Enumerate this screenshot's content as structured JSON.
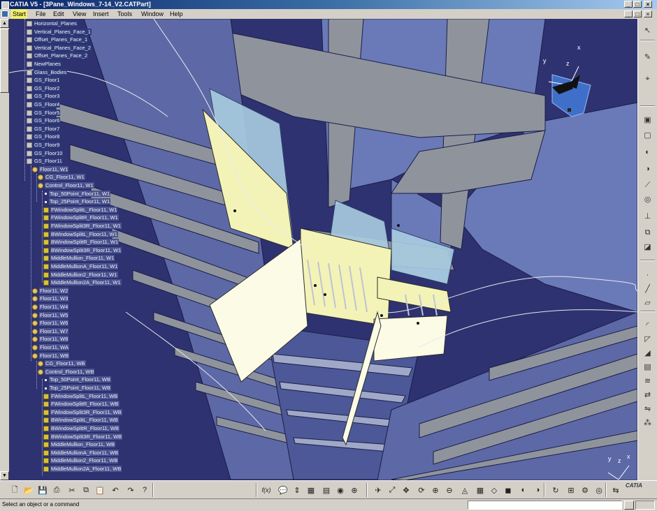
{
  "window": {
    "title": "CATIA V5 - [3Pane_Windows_7-14_V2.CATPart]",
    "buttons": [
      "_",
      "□",
      "×"
    ],
    "inner_buttons": [
      "_",
      "□",
      "×"
    ]
  },
  "menu": {
    "items": [
      "Start",
      "File",
      "Edit",
      "View",
      "Insert",
      "Tools",
      "Window",
      "Help"
    ]
  },
  "tree": {
    "nodes": [
      {
        "label": "Horizontal_Planes",
        "icon": "plane-icon",
        "level": 0
      },
      {
        "label": "Vertical_Planes_Face_1",
        "icon": "plane-icon",
        "level": 0
      },
      {
        "label": "Offset_Planes_Face_1",
        "icon": "plane-icon",
        "level": 0
      },
      {
        "label": "Vertical_Planes_Face_2",
        "icon": "plane-icon",
        "level": 0
      },
      {
        "label": "Offset_Planes_Face_2",
        "icon": "plane-icon",
        "level": 0
      },
      {
        "label": "NewPlanes",
        "icon": "plane-icon",
        "level": 0
      },
      {
        "label": "Glass_Bodies",
        "icon": "plane-icon",
        "level": 0
      },
      {
        "label": "GS_Floor1",
        "icon": "plane-icon",
        "level": 0
      },
      {
        "label": "GS_Floor2",
        "icon": "plane-icon",
        "level": 0
      },
      {
        "label": "GS_Floor3",
        "icon": "plane-icon",
        "level": 0
      },
      {
        "label": "GS_Floor4",
        "icon": "plane-icon",
        "level": 0
      },
      {
        "label": "GS_Floor5",
        "icon": "plane-icon",
        "level": 0
      },
      {
        "label": "GS_Floor6",
        "icon": "plane-icon",
        "level": 0
      },
      {
        "label": "GS_Floor7",
        "icon": "plane-icon",
        "level": 0
      },
      {
        "label": "GS_Floor8",
        "icon": "plane-icon",
        "level": 0
      },
      {
        "label": "GS_Floor9",
        "icon": "plane-icon",
        "level": 0
      },
      {
        "label": "GS_Floor10",
        "icon": "plane-icon",
        "level": 0
      },
      {
        "label": "GS_Floor11",
        "icon": "plane-icon",
        "level": 0
      },
      {
        "label": "Floor11, W1",
        "icon": "geoset-icon",
        "level": 1
      },
      {
        "label": "CG_Floor11, W1",
        "icon": "geoset-icon",
        "level": 2
      },
      {
        "label": "Control_Floor11, W1",
        "icon": "geoset-icon",
        "level": 2
      },
      {
        "label": "Top_50Point_Floor11, W1",
        "icon": "point-icon",
        "level": 3
      },
      {
        "label": "Top_25Point_Floor11, W1",
        "icon": "point-icon",
        "level": 3
      },
      {
        "label": "FWindowSplitL_Floor11, W1",
        "icon": "split-icon",
        "level": 3
      },
      {
        "label": "FWindowSplitR_Floor11, W1",
        "icon": "split-icon",
        "level": 3
      },
      {
        "label": "FWindowSplit3R_Floor11, W1",
        "icon": "split-icon",
        "level": 3
      },
      {
        "label": "BWindowSplitL_Floor11, W1",
        "icon": "split-icon",
        "level": 3
      },
      {
        "label": "BWindowSplitR_Floor11, W1",
        "icon": "split-icon",
        "level": 3
      },
      {
        "label": "BWindowSplit3R_Floor11, W1",
        "icon": "split-icon",
        "level": 3
      },
      {
        "label": "MiddleMullion_Floor11, W1",
        "icon": "split-icon",
        "level": 3
      },
      {
        "label": "MiddleMullionA_Floor11, W1",
        "icon": "split-icon",
        "level": 3
      },
      {
        "label": "MiddleMullion2_Floor11, W1",
        "icon": "split-icon",
        "level": 3
      },
      {
        "label": "MiddleMullion2A_Floor11, W1",
        "icon": "split-icon",
        "level": 3
      },
      {
        "label": "Floor11, W2",
        "icon": "geoset-icon",
        "level": 1
      },
      {
        "label": "Floor11, W3",
        "icon": "geoset-icon",
        "level": 1
      },
      {
        "label": "Floor11, W4",
        "icon": "geoset-icon",
        "level": 1
      },
      {
        "label": "Floor11, W5",
        "icon": "geoset-icon",
        "level": 1
      },
      {
        "label": "Floor11, W6",
        "icon": "geoset-icon",
        "level": 1
      },
      {
        "label": "Floor11, W7",
        "icon": "geoset-icon",
        "level": 1
      },
      {
        "label": "Floor11, W8",
        "icon": "geoset-icon",
        "level": 1
      },
      {
        "label": "Floor11, WA",
        "icon": "geoset-icon",
        "level": 1
      },
      {
        "label": "Floor11, WB",
        "icon": "geoset-icon",
        "level": 1
      },
      {
        "label": "CG_Floor11, WB",
        "icon": "geoset-icon",
        "level": 2
      },
      {
        "label": "Control_Floor11, WB",
        "icon": "geoset-icon",
        "level": 2
      },
      {
        "label": "Top_50Point_Floor11, WB",
        "icon": "point-icon",
        "level": 3
      },
      {
        "label": "Top_25Point_Floor11, WB",
        "icon": "point-icon",
        "level": 3
      },
      {
        "label": "FWindowSplitL_Floor11, WB",
        "icon": "split-icon",
        "level": 3
      },
      {
        "label": "FWindowSplitR_Floor11, WB",
        "icon": "split-icon",
        "level": 3
      },
      {
        "label": "FWindowSplit3R_Floor11, WB",
        "icon": "split-icon",
        "level": 3
      },
      {
        "label": "BWindowSplitL_Floor11, WB",
        "icon": "split-icon",
        "level": 3
      },
      {
        "label": "BWindowSplitR_Floor11, WB",
        "icon": "split-icon",
        "level": 3
      },
      {
        "label": "BWindowSplit3R_Floor11, WB",
        "icon": "split-icon",
        "level": 3
      },
      {
        "label": "MiddleMullion_Floor11, WB",
        "icon": "split-icon",
        "level": 3
      },
      {
        "label": "MiddleMullionA_Floor11, WB",
        "icon": "split-icon",
        "level": 3
      },
      {
        "label": "MiddleMullion2_Floor11, WB",
        "icon": "split-icon",
        "level": 3
      },
      {
        "label": "MiddleMullion2A_Floor11, WB",
        "icon": "split-icon",
        "level": 3
      }
    ]
  },
  "compass": {
    "x_label": "x",
    "y_label": "y",
    "z_label": "z"
  },
  "viewport_axes": {
    "x_label": "x",
    "y_label": "y",
    "z_label": "z"
  },
  "right_toolbar": {
    "icons": [
      "select-arrow-icon",
      "sketch-icon",
      "sketch-analysis-icon",
      "pad-icon",
      "pocket-icon",
      "shaft-icon",
      "groove-icon",
      "rib-icon",
      "hole-icon",
      "stiffener-icon",
      "multi-section-icon",
      "split-body-icon",
      "point-icon",
      "line-icon",
      "plane-icon",
      "fillet-icon",
      "chamfer-icon",
      "draft-icon",
      "shell-icon",
      "thread-icon",
      "translate-icon",
      "mirror-icon",
      "pattern-icon"
    ]
  },
  "bottom_toolbar": {
    "icons": [
      "new-icon",
      "open-icon",
      "save-icon",
      "print-icon",
      "cut-icon",
      "copy-icon",
      "paste-icon",
      "undo-icon",
      "redo-icon",
      "whats-this-icon",
      "formula-icon",
      "knowledge-icon",
      "parameter-icon",
      "table-icon",
      "catalog-icon",
      "apply-material-icon",
      "measure-icon",
      "fly-mode-icon",
      "fit-all-icon",
      "pan-icon",
      "rotate-icon",
      "zoom-in-icon",
      "zoom-out-icon",
      "normal-view-icon",
      "quick-view-icon",
      "iso-view-icon",
      "render-style-icon",
      "hide-show-icon",
      "swap-visible-icon",
      "update-icon",
      "boolean-icon",
      "assembly-icon",
      "visibility-icon",
      "swap-workbench-icon"
    ],
    "formula_label": "f(x)"
  },
  "status": {
    "message": "Select an object or a command",
    "command_input": ""
  },
  "logo": {
    "text": "CATIA"
  },
  "colors": {
    "viewport_bg": "#2e3270",
    "panel_yellow": "#f3f3b8",
    "panel_cream": "#fbfbe6",
    "glass_blue": "#a9cde0",
    "floor_grey": "#8f949c",
    "facade_blue": "#6a7ab8"
  }
}
